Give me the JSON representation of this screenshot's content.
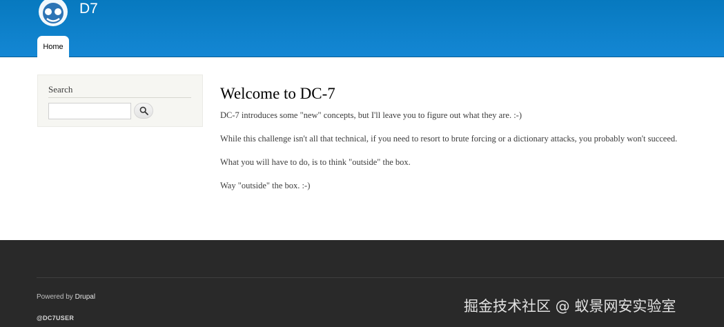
{
  "header": {
    "site_name": "D7",
    "menu": [
      {
        "label": "Home"
      }
    ]
  },
  "sidebar": {
    "search": {
      "title": "Search",
      "input_value": ""
    }
  },
  "content": {
    "title": "Welcome to DC-7",
    "paragraphs": [
      "DC-7 introduces some \"new\" concepts, but I'll leave you to figure out what they are.  :-)",
      "While this challenge isn't all that technical, if you need to resort to brute forcing or a dictionary attacks, you probably won't succeed.",
      "What you will have to do, is to think \"outside\" the box.",
      "Way \"outside\" the box.  :-)"
    ]
  },
  "footer": {
    "powered_by_prefix": "Powered by",
    "powered_by_link": "Drupal",
    "user": "@DC7USER",
    "watermark": "掘金技术社区 @ 蚁景网安实验室"
  },
  "icons": {
    "logo": "drupal-logo-icon",
    "search": "search-icon"
  },
  "colors": {
    "header_blue": "#0779bf",
    "footer_bg": "#292929",
    "sidebar_bg": "#f6f6f2"
  }
}
